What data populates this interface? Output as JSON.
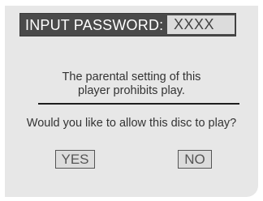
{
  "dialog": {
    "password_label": "INPUT PASSWORD:",
    "password_value": "XXXX",
    "message_line1": "The parental setting of this",
    "message_line2": "player prohibits play.",
    "question": "Would you like to allow this disc to play?",
    "yes_label": "YES",
    "no_label": "NO"
  },
  "colors": {
    "panel_background": "#e7e7e7",
    "header_bar": "#4a4a4a",
    "field_background": "#dcdcdc",
    "text": "#333333"
  }
}
